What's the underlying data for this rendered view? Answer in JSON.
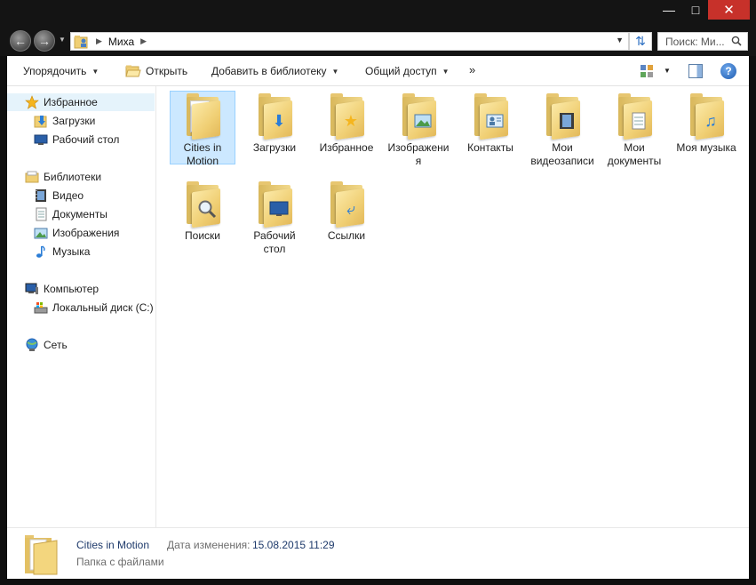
{
  "titlebar": {
    "minimize": "—",
    "maximize": "□",
    "close": "✕"
  },
  "address": {
    "path": [
      "Миха"
    ],
    "search_placeholder": "Поиск: Ми..."
  },
  "toolbar": {
    "organize": "Упорядочить",
    "open": "Открыть",
    "add_to_library": "Добавить в библиотеку",
    "share": "Общий доступ",
    "more": "»",
    "help": "?"
  },
  "nav": {
    "favorites": "Избранное",
    "downloads": "Загрузки",
    "desktop": "Рабочий стол",
    "libraries": "Библиотеки",
    "video": "Видео",
    "documents": "Документы",
    "images": "Изображения",
    "music": "Музыка",
    "computer": "Компьютер",
    "local_disk": "Локальный диск (C:)",
    "network": "Сеть"
  },
  "items": [
    {
      "label": "Cities in Motion",
      "icon": "folder-icon",
      "selected": true
    },
    {
      "label": "Загрузки",
      "icon": "downloads-folder-icon"
    },
    {
      "label": "Избранное",
      "icon": "favorites-folder-icon"
    },
    {
      "label": "Изображения",
      "icon": "pictures-folder-icon"
    },
    {
      "label": "Контакты",
      "icon": "contacts-folder-icon"
    },
    {
      "label": "Мои видеозаписи",
      "icon": "videos-folder-icon"
    },
    {
      "label": "Мои документы",
      "icon": "documents-folder-icon"
    },
    {
      "label": "Моя музыка",
      "icon": "music-folder-icon"
    },
    {
      "label": "Поиски",
      "icon": "searches-folder-icon"
    },
    {
      "label": "Рабочий стол",
      "icon": "desktop-folder-icon"
    },
    {
      "label": "Ссылки",
      "icon": "links-folder-icon"
    }
  ],
  "status": {
    "name": "Cities in Motion",
    "type": "Папка с файлами",
    "date_label": "Дата изменения:",
    "date": "15.08.2015 11:29"
  },
  "colors": {
    "selection": "#cce8ff",
    "close": "#c7312a",
    "frame": "#141414"
  }
}
